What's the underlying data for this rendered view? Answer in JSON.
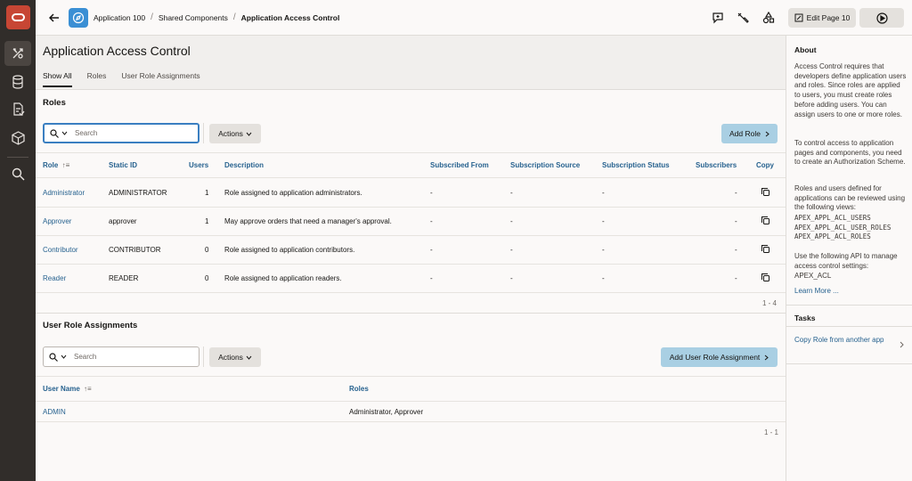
{
  "topbar": {
    "breadcrumbs": [
      "Application 100",
      "Shared Components",
      "Application Access Control"
    ],
    "edit_page_label": "Edit Page 10"
  },
  "page": {
    "title": "Application Access Control",
    "tabs": [
      "Show All",
      "Roles",
      "User Role Assignments"
    ]
  },
  "roles": {
    "title": "Roles",
    "search_placeholder": "Search",
    "actions_label": "Actions",
    "add_label": "Add Role",
    "columns": [
      "Role",
      "Static ID",
      "Users",
      "Description",
      "Subscribed From",
      "Subscription Source",
      "Subscription Status",
      "Subscribers",
      "Copy"
    ],
    "rows": [
      {
        "role": "Administrator",
        "static_id": "ADMINISTRATOR",
        "users": "1",
        "description": "Role assigned to application administrators.",
        "sub_from": "-",
        "sub_source": "-",
        "sub_status": "-",
        "subscribers": "-"
      },
      {
        "role": "Approver",
        "static_id": "approver",
        "users": "1",
        "description": "May approve orders that need a manager's approval.",
        "sub_from": "-",
        "sub_source": "-",
        "sub_status": "-",
        "subscribers": "-"
      },
      {
        "role": "Contributor",
        "static_id": "CONTRIBUTOR",
        "users": "0",
        "description": "Role assigned to application contributors.",
        "sub_from": "-",
        "sub_source": "-",
        "sub_status": "-",
        "subscribers": "-"
      },
      {
        "role": "Reader",
        "static_id": "READER",
        "users": "0",
        "description": "Role assigned to application readers.",
        "sub_from": "-",
        "sub_source": "-",
        "sub_status": "-",
        "subscribers": "-"
      }
    ],
    "pagination": "1 - 4"
  },
  "assignments": {
    "title": "User Role Assignments",
    "search_placeholder": "Search",
    "actions_label": "Actions",
    "add_label": "Add User Role Assignment",
    "columns": [
      "User Name",
      "Roles"
    ],
    "rows": [
      {
        "user": "ADMIN",
        "roles": "Administrator, Approver"
      }
    ],
    "pagination": "1 - 1"
  },
  "sidebar": {
    "about_title": "About",
    "about_p1": "Access Control requires that developers define application users and roles. Since roles are applied to users, you must create roles before adding users. You can assign users to one or more roles.",
    "about_p2": "To control access to application pages and components, you need to create an Authorization Scheme.",
    "about_p3": "Roles and users defined for applications can be reviewed using the following views:",
    "views": [
      "APEX_APPL_ACL_USERS",
      "APEX_APPL_ACL_USER_ROLES",
      "APEX_APPL_ACL_ROLES"
    ],
    "about_p4": "Use the following API to manage access control settings:",
    "api": "APEX_ACL",
    "learn_more": "Learn More ...",
    "tasks_title": "Tasks",
    "task_copy": "Copy Role from another app"
  },
  "colors": {
    "rail": "#312d2a",
    "logo": "#c74634",
    "app_icon": "#3a8fd4",
    "link": "#27628f",
    "primary_button": "#a9cfe3",
    "focus": "#3a7fc1"
  },
  "icons": {
    "rail": [
      "oracle-logo-icon",
      "shared-components-icon",
      "database-icon",
      "sql-script-icon",
      "package-icon",
      "search-icon"
    ],
    "topbar": [
      "back-arrow-icon",
      "app-compass-icon",
      "feedback-icon",
      "wrench-icon",
      "shapes-icon",
      "edit-page-icon",
      "run-icon"
    ]
  }
}
